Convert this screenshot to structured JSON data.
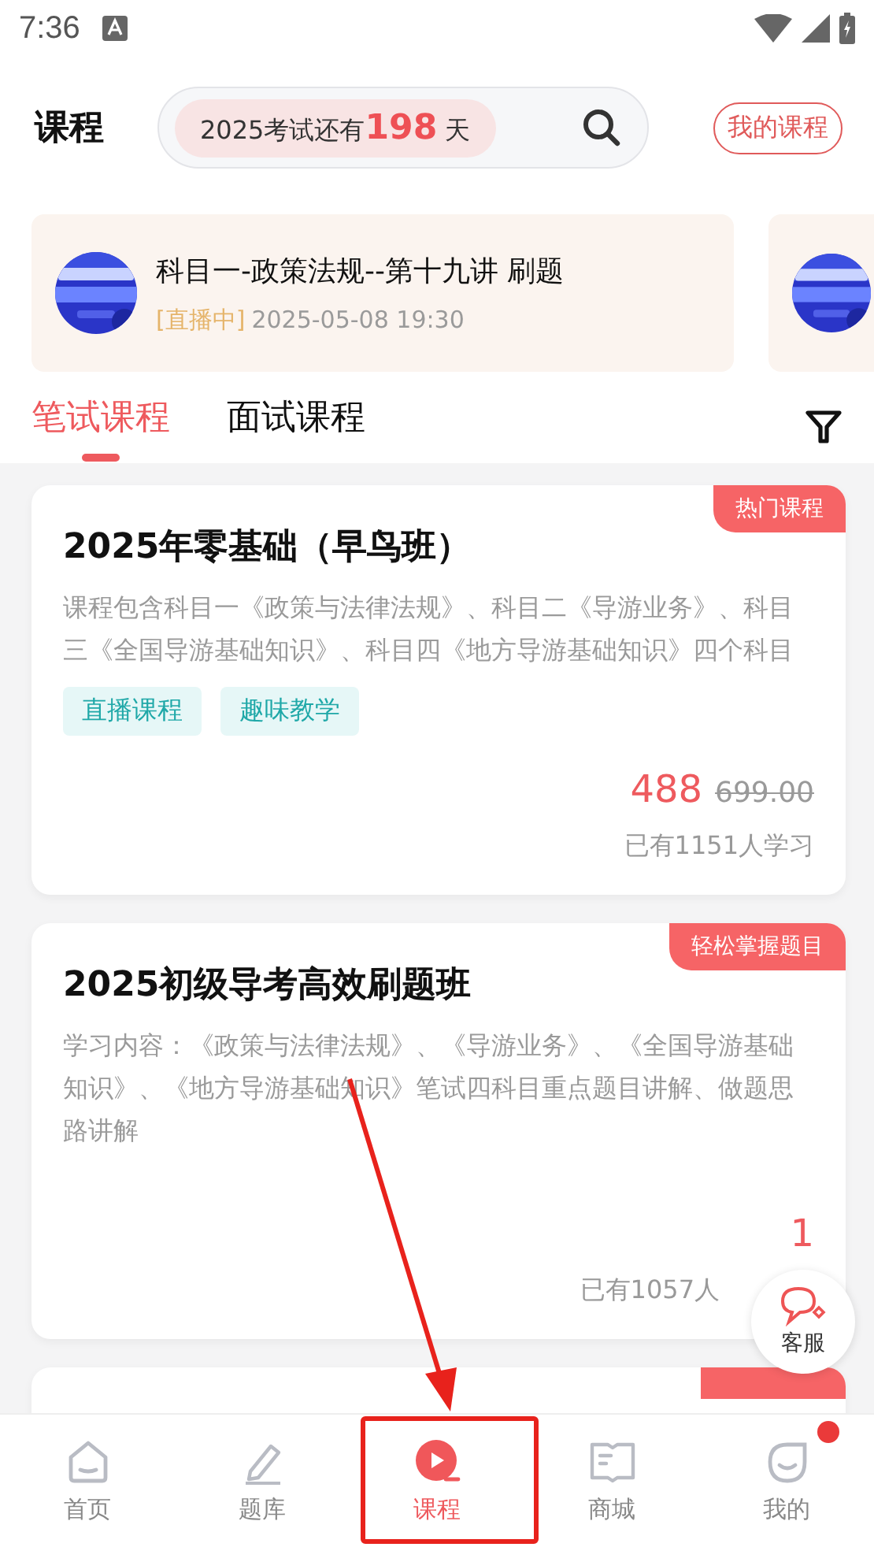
{
  "status_bar": {
    "time": "7:36"
  },
  "header": {
    "title": "课程",
    "countdown": "2025考试还有**198** 天",
    "my_courses_button": "我的课程"
  },
  "live_banners": [
    {
      "kind": "live",
      "title": "科目一-政策法规--第十九讲 刷题",
      "status": "[直播中]",
      "time": "2025-05-08 19:30"
    },
    {
      "kind": "picture"
    }
  ],
  "tabs": [
    {
      "label": "笔试课程",
      "selected": true
    },
    {
      "label": "面试课程",
      "selected": false
    }
  ],
  "courses": [
    {
      "kind": "full",
      "title": "2025年零基础（早鸟班）",
      "tag": "热门课程",
      "description": "课程包含科目一《政策与法律法规》、科目二《导游业务》、科目三《全国导游基础知识》、科目四《地方导游基础知识》四个科目",
      "labels": [
        "直播课程",
        "趣味教学"
      ],
      "price": "488",
      "original_price": "699.00",
      "learners": "已有1151人学习"
    },
    {
      "kind": "full",
      "title": "2025初级导考高效刷题班",
      "tag": "轻松掌握题目",
      "description": "学习内容：《政策与法律法规》、《导游业务》、《全国导游基础知识》、《地方导游基础知识》笔试四科目重点题目讲解、做题思路讲解",
      "price": "1",
      "learners": "已有1057人"
    },
    {
      "kind": "partial"
    }
  ],
  "customer_service": {
    "label": "客服"
  },
  "bottom_nav": [
    {
      "label": "首页",
      "selected": false,
      "badge": false
    },
    {
      "label": "题库",
      "selected": false,
      "badge": false
    },
    {
      "label": "课程",
      "selected": true,
      "badge": false
    },
    {
      "label": "商城",
      "selected": false,
      "badge": false
    },
    {
      "label": "我的",
      "selected": false,
      "badge": true
    }
  ]
}
